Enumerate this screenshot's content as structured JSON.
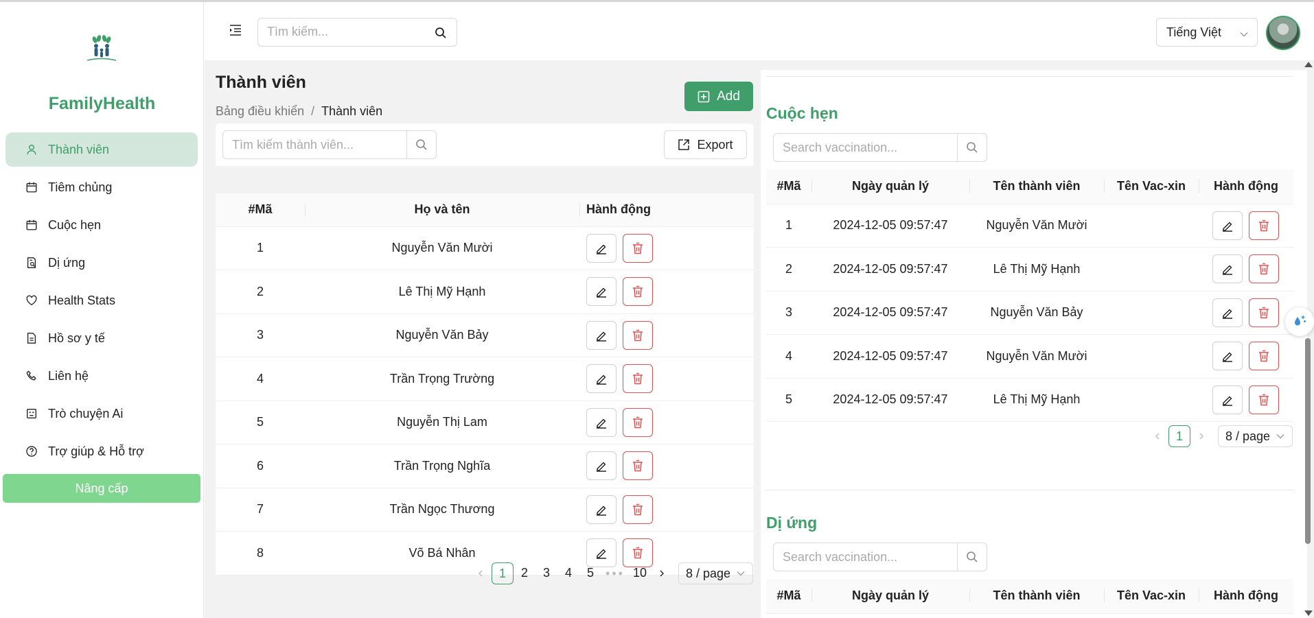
{
  "app": {
    "brand": "FamilyHealth"
  },
  "colors": {
    "accent": "#3f9e6a",
    "upgrade": "#7ed68f",
    "danger": "#e05050"
  },
  "header": {
    "search_placeholder": "Tìm kiếm...",
    "language": "Tiếng Việt"
  },
  "sidebar": {
    "items": [
      {
        "label": "Thành viên",
        "icon": "user-icon"
      },
      {
        "label": "Tiêm chủng",
        "icon": "calendar-icon"
      },
      {
        "label": "Cuộc hẹn",
        "icon": "calendar-icon"
      },
      {
        "label": "Dị ứng",
        "icon": "report-icon"
      },
      {
        "label": "Health Stats",
        "icon": "heart-icon"
      },
      {
        "label": "Hồ sơ y tế",
        "icon": "file-icon"
      },
      {
        "label": "Liên hệ",
        "icon": "phone-icon"
      },
      {
        "label": "Trò chuyện Ai",
        "icon": "robot-icon"
      },
      {
        "label": "Trợ giúp & Hỗ trợ",
        "icon": "help-icon"
      }
    ],
    "upgrade_label": "Nâng cấp"
  },
  "page": {
    "title": "Thành viên",
    "breadcrumb": {
      "root": "Bảng điều khiển",
      "separator": "/",
      "current": "Thành viên"
    },
    "add_label": "Add"
  },
  "members": {
    "search_placeholder": "Tìm kiếm thành viên...",
    "export_label": "Export",
    "columns": [
      "#Mã",
      "Họ và tên",
      "Hành động"
    ],
    "rows": [
      {
        "id": "1",
        "name": "Nguyễn Văn Mười"
      },
      {
        "id": "2",
        "name": "Lê Thị Mỹ Hạnh"
      },
      {
        "id": "3",
        "name": "Nguyễn Văn Bảy"
      },
      {
        "id": "4",
        "name": "Trần Trọng Trường"
      },
      {
        "id": "5",
        "name": "Nguyễn Thị Lam"
      },
      {
        "id": "6",
        "name": "Trần Trọng Nghĩa"
      },
      {
        "id": "7",
        "name": "Trần Ngọc Thương"
      },
      {
        "id": "8",
        "name": "Võ Bá Nhân"
      }
    ],
    "pagination": {
      "pages": [
        "1",
        "2",
        "3",
        "4",
        "5"
      ],
      "ellipsis": "•••",
      "last": "10",
      "current": "1",
      "page_size": "8 / page"
    }
  },
  "appointments": {
    "title": "Cuộc hẹn",
    "search_placeholder": "Search vaccination...",
    "columns": [
      "#Mã",
      "Ngày quản lý",
      "Tên thành viên",
      "Tên Vac-xin",
      "Hành động"
    ],
    "rows": [
      {
        "id": "1",
        "date": "2024-12-05 09:57:47",
        "member": "Nguyễn Văn Mười",
        "vaccine": ""
      },
      {
        "id": "2",
        "date": "2024-12-05 09:57:47",
        "member": "Lê Thị Mỹ Hạnh",
        "vaccine": ""
      },
      {
        "id": "3",
        "date": "2024-12-05 09:57:47",
        "member": "Nguyễn Văn Bảy",
        "vaccine": ""
      },
      {
        "id": "4",
        "date": "2024-12-05 09:57:47",
        "member": "Nguyễn Văn Mười",
        "vaccine": ""
      },
      {
        "id": "5",
        "date": "2024-12-05 09:57:47",
        "member": "Lê Thị Mỹ Hạnh",
        "vaccine": ""
      }
    ],
    "pagination": {
      "current": "1",
      "page_size": "8 / page"
    }
  },
  "allergies": {
    "title": "Dị ứng",
    "search_placeholder": "Search vaccination...",
    "columns": [
      "#Mã",
      "Ngày quản lý",
      "Tên thành viên",
      "Tên Vac-xin",
      "Hành động"
    ]
  }
}
